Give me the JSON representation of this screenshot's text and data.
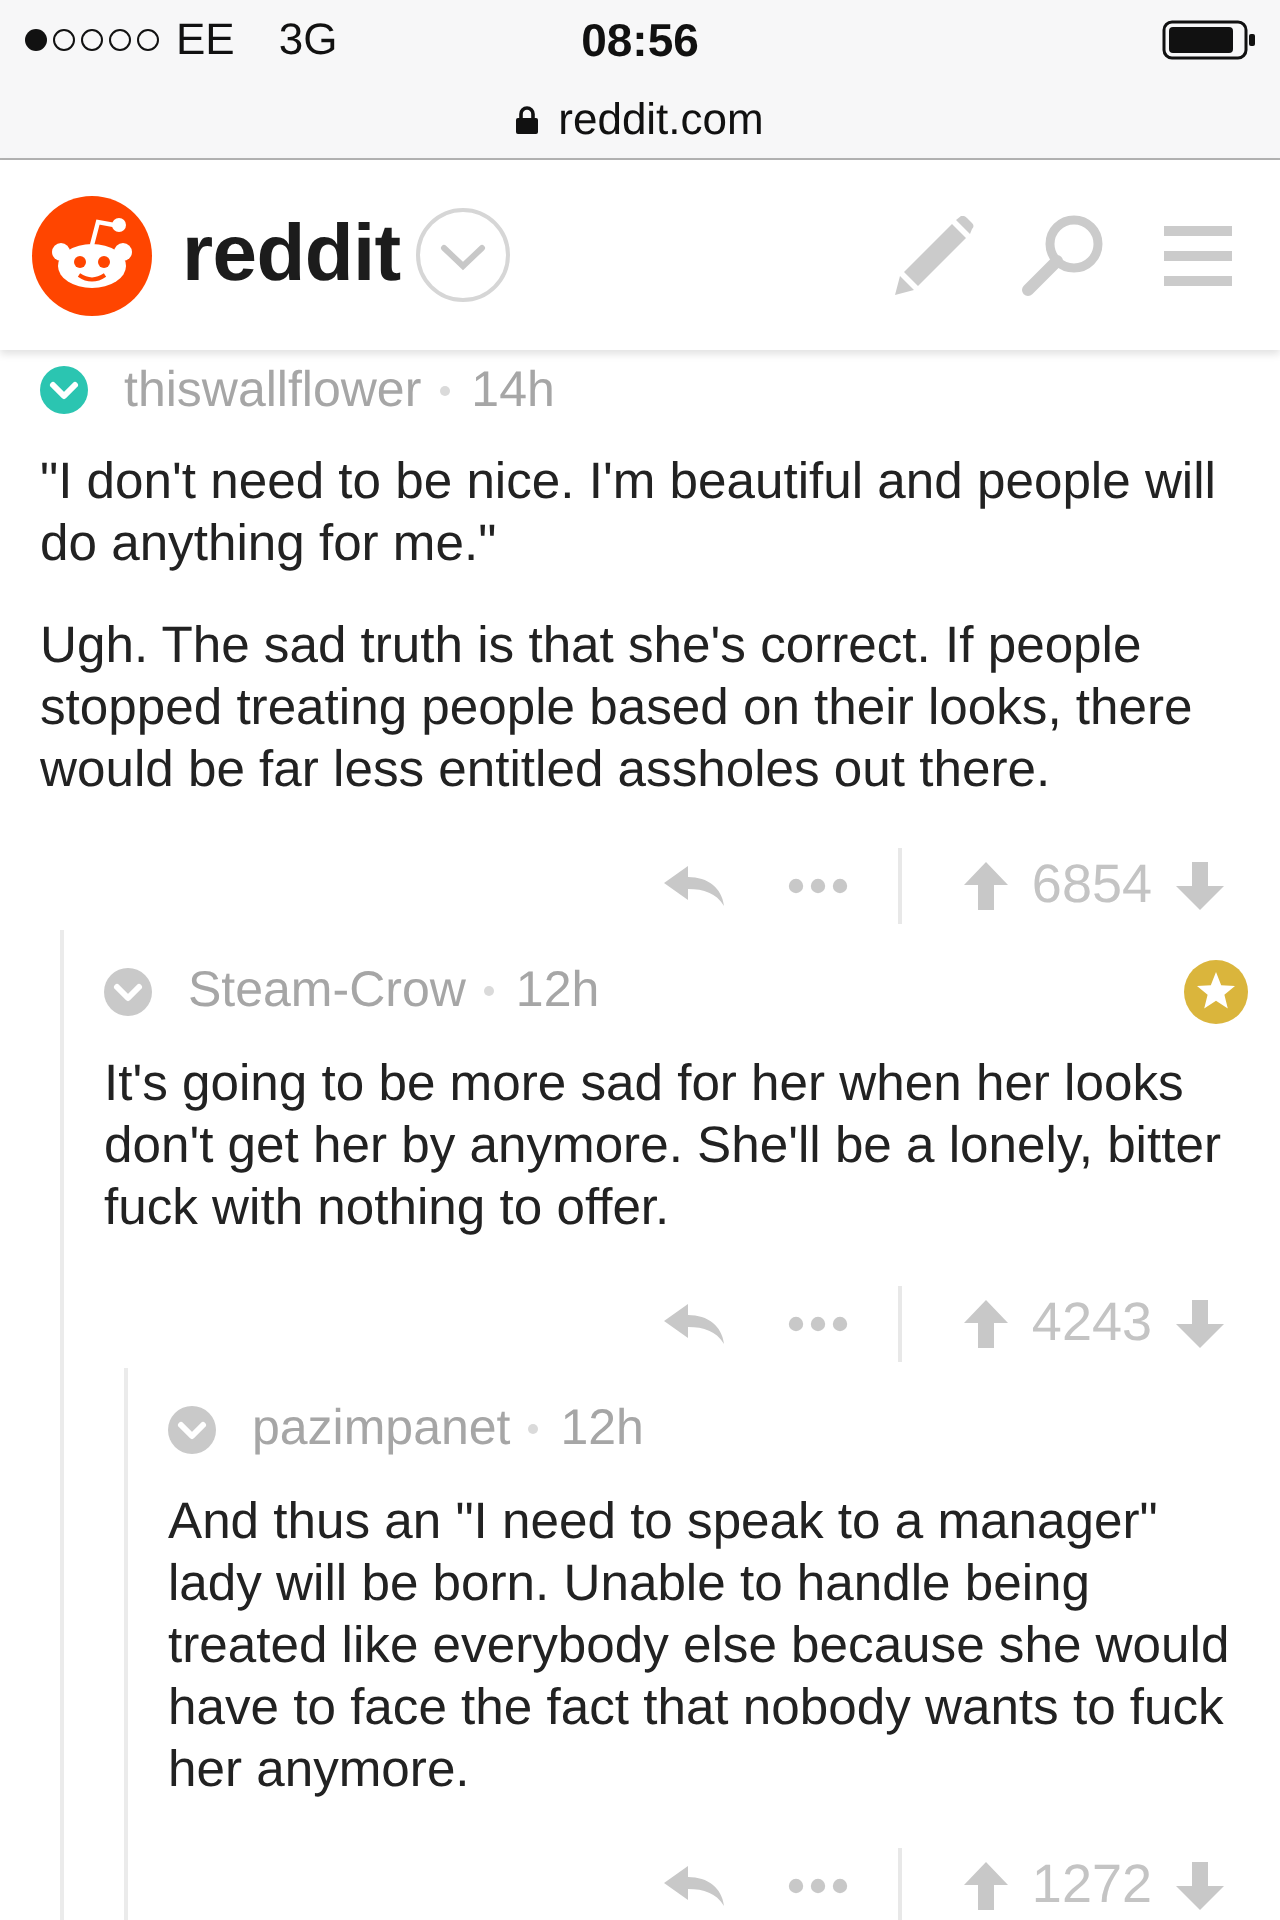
{
  "status_bar": {
    "carrier": "EE",
    "network": "3G",
    "time": "08:56"
  },
  "address_bar": {
    "url": "reddit.com"
  },
  "header": {
    "logo_text": "reddit"
  },
  "comments": [
    {
      "author": "thiswallflower",
      "time": "14h",
      "color": "#2bc5b1",
      "gilded": false,
      "paragraphs": [
        "\"I don't need to be nice. I'm beautiful and people will do anything for me.\"",
        "Ugh. The sad truth is that she's correct. If people stopped treating people based on their looks, there would be far less entitled assholes out there."
      ],
      "score": "6854",
      "children": [
        {
          "author": "Steam-Crow",
          "time": "12h",
          "color": "#c9c9c9",
          "gilded": true,
          "paragraphs": [
            "It's going to be more sad for her when her looks don't get her by anymore. She'll be a lonely, bitter fuck with nothing to offer."
          ],
          "score": "4243",
          "children": [
            {
              "author": "pazimpanet",
              "time": "12h",
              "color": "#c9c9c9",
              "gilded": false,
              "paragraphs": [
                "And thus an \"I need to speak to a manager\" lady will be born. Unable to handle being treated like everybody else because she would have to face the fact that nobody wants to fuck her anymore."
              ],
              "score": "1272"
            }
          ]
        }
      ]
    }
  ]
}
